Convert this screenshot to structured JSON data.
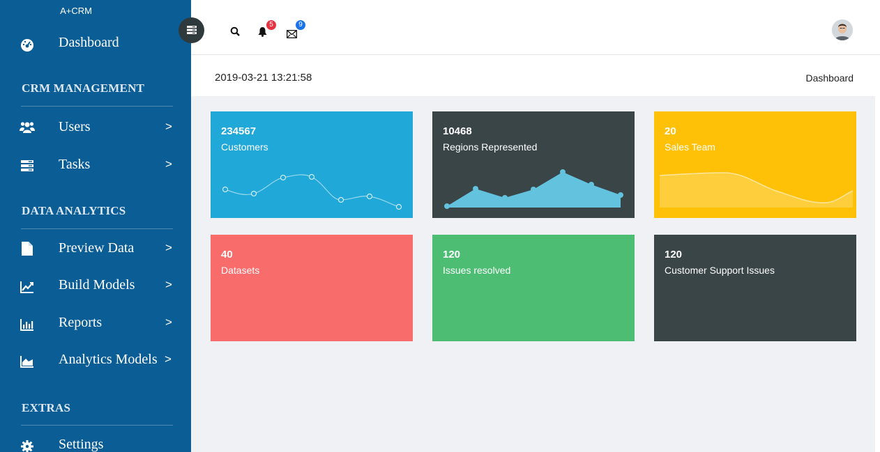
{
  "brand": "A+CRM",
  "sidebar": {
    "dashboard_label": "Dashboard",
    "sections": [
      {
        "title": "CRM MANAGEMENT"
      },
      {
        "title": "DATA ANALYTICS"
      },
      {
        "title": "EXTRAS"
      }
    ],
    "items": [
      {
        "label": "Users",
        "icon": "users-icon",
        "arrow": ">"
      },
      {
        "label": "Tasks",
        "icon": "tasks-icon",
        "arrow": ">"
      },
      {
        "label": "Preview Data",
        "icon": "file-icon",
        "arrow": ">"
      },
      {
        "label": "Build Models",
        "icon": "line-chart-icon",
        "arrow": ">"
      },
      {
        "label": "Reports",
        "icon": "bar-chart-icon",
        "arrow": ">"
      },
      {
        "label": "Analytics Models",
        "icon": "area-chart-icon",
        "arrow": ">"
      },
      {
        "label": "Settings",
        "icon": "gear-icon"
      }
    ]
  },
  "header": {
    "notifications_count": "5",
    "messages_count": "9",
    "notification_badge_color": "#e7333f",
    "message_badge_color": "#1a73e8"
  },
  "breadcrumb": {
    "timestamp": "2019-03-21 13:21:58",
    "current": "Dashboard"
  },
  "cards": [
    {
      "value": "234567",
      "label": "Customers",
      "color": "#20a8d8"
    },
    {
      "value": "10468",
      "label": "Regions Represented",
      "color": "#3a4548"
    },
    {
      "value": "20",
      "label": "Sales Team",
      "color": "#ffc107"
    },
    {
      "value": "40",
      "label": "Datasets",
      "color": "#f86c6b"
    },
    {
      "value": "120",
      "label": "Issues resolved",
      "color": "#4dbd74"
    },
    {
      "value": "120",
      "label": "Customer Support Issues",
      "color": "#3a4548"
    }
  ]
}
